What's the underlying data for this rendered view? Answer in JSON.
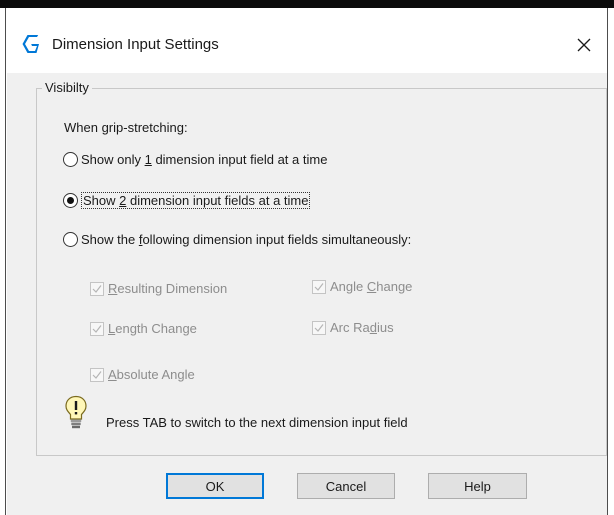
{
  "dialog": {
    "title": "Dimension Input Settings",
    "icon": "app-logo-g-icon",
    "close_glyph": "✕",
    "accent_color": "#0078d7"
  },
  "visibility": {
    "group_label": "Visibilty",
    "grip_label": "When grip-stretching:",
    "options": [
      {
        "pre": "Show only ",
        "u": "1",
        "post": " dimension input field at a time",
        "checked": false
      },
      {
        "pre": "Show ",
        "u": "2",
        "post": " dimension input fields at a time",
        "checked": true
      },
      {
        "pre": "Show the ",
        "u": "f",
        "post": "ollowing dimension input fields simultaneously:",
        "checked": false
      }
    ],
    "checkboxes": [
      {
        "u": "R",
        "post": "esulting Dimension",
        "checked": true,
        "enabled": false
      },
      {
        "pre": "Angle ",
        "u": "C",
        "post": "hange",
        "checked": true,
        "enabled": false
      },
      {
        "u": "L",
        "post": "ength Change",
        "checked": true,
        "enabled": false
      },
      {
        "pre": "Arc Ra",
        "u": "d",
        "post": "ius",
        "checked": true,
        "enabled": false
      },
      {
        "u": "A",
        "post": "bsolute Angle",
        "checked": true,
        "enabled": false
      }
    ],
    "tip": "Press TAB to switch to the next dimension input field",
    "tip_icon": "lightbulb-icon"
  },
  "buttons": {
    "ok": "OK",
    "cancel": "Cancel",
    "help": "Help"
  }
}
